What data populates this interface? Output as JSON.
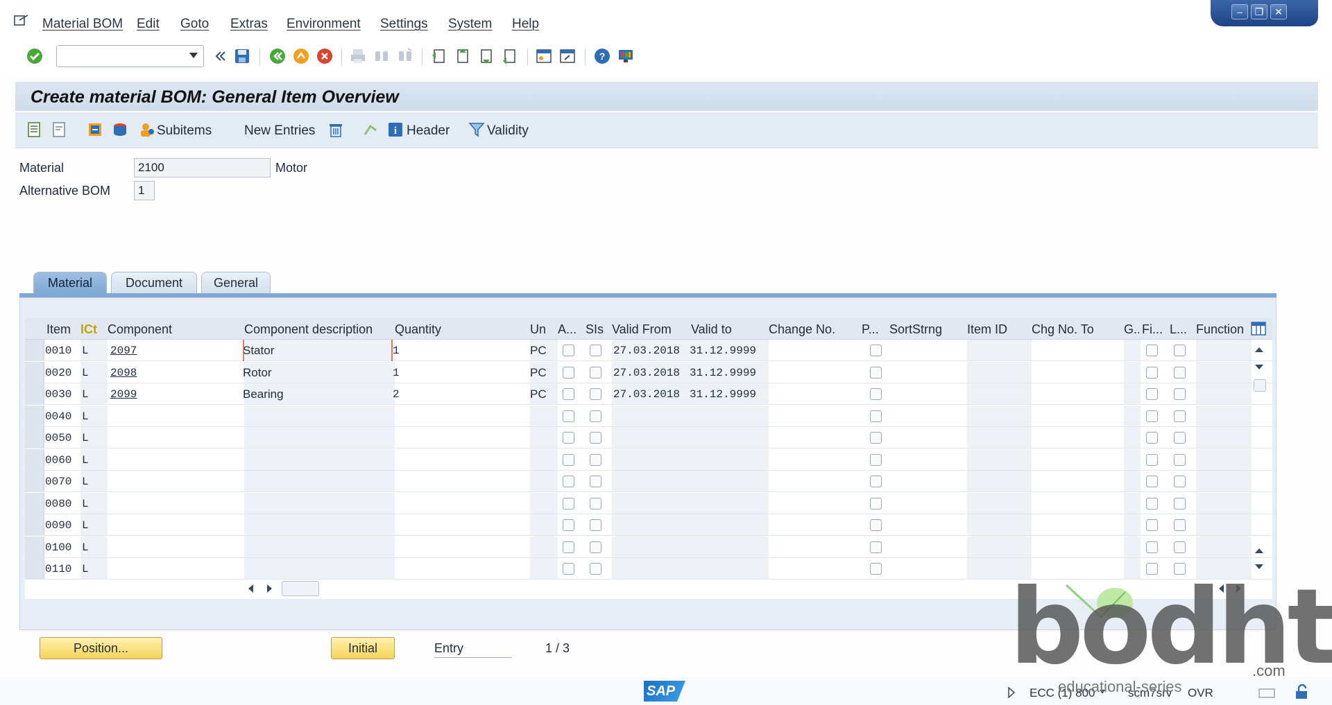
{
  "menubar": {
    "items": [
      "Material BOM",
      "Edit",
      "Goto",
      "Extras",
      "Environment",
      "Settings",
      "System",
      "Help"
    ]
  },
  "toolbar": {
    "command_value": ""
  },
  "title": "Create material BOM: General Item Overview",
  "app_toolbar": {
    "subitems": "Subitems",
    "new_entries": "New Entries",
    "header": "Header",
    "validity": "Validity"
  },
  "form": {
    "material_label": "Material",
    "material_value": "2100",
    "material_desc": "Motor",
    "altbom_label": "Alternative BOM",
    "altbom_value": "1"
  },
  "tabs": [
    "Material",
    "Document",
    "General"
  ],
  "table": {
    "columns": [
      "Item",
      "ICt",
      "Component",
      "Component description",
      "Quantity",
      "Un",
      "A...",
      "SIs",
      "Valid From",
      "Valid to",
      "Change No.",
      "P...",
      "SortStrng",
      "Item ID",
      "Chg No. To",
      "G..",
      "Fi...",
      "L...",
      "Function"
    ],
    "rows": [
      {
        "item": "0010",
        "ict": "L",
        "component": "2097",
        "desc": "Stator",
        "qty": "1",
        "un": "PC",
        "from": "27.03.2018",
        "to": "31.12.9999"
      },
      {
        "item": "0020",
        "ict": "L",
        "component": "2098",
        "desc": "Rotor",
        "qty": "1",
        "un": "PC",
        "from": "27.03.2018",
        "to": "31.12.9999"
      },
      {
        "item": "0030",
        "ict": "L",
        "component": "2099",
        "desc": "Bearing",
        "qty": "2",
        "un": "PC",
        "from": "27.03.2018",
        "to": "31.12.9999"
      },
      {
        "item": "0040",
        "ict": "L",
        "component": "",
        "desc": "",
        "qty": "",
        "un": "",
        "from": "",
        "to": ""
      },
      {
        "item": "0050",
        "ict": "L",
        "component": "",
        "desc": "",
        "qty": "",
        "un": "",
        "from": "",
        "to": ""
      },
      {
        "item": "0060",
        "ict": "L",
        "component": "",
        "desc": "",
        "qty": "",
        "un": "",
        "from": "",
        "to": ""
      },
      {
        "item": "0070",
        "ict": "L",
        "component": "",
        "desc": "",
        "qty": "",
        "un": "",
        "from": "",
        "to": ""
      },
      {
        "item": "0080",
        "ict": "L",
        "component": "",
        "desc": "",
        "qty": "",
        "un": "",
        "from": "",
        "to": ""
      },
      {
        "item": "0090",
        "ict": "L",
        "component": "",
        "desc": "",
        "qty": "",
        "un": "",
        "from": "",
        "to": ""
      },
      {
        "item": "0100",
        "ict": "L",
        "component": "",
        "desc": "",
        "qty": "",
        "un": "",
        "from": "",
        "to": ""
      },
      {
        "item": "0110",
        "ict": "L",
        "component": "",
        "desc": "",
        "qty": "",
        "un": "",
        "from": "",
        "to": ""
      }
    ]
  },
  "bottom": {
    "position_label": "Position...",
    "initial_label": "Initial",
    "entry_label": "Entry",
    "entry_count": "1 / 3"
  },
  "status": {
    "sap": "SAP",
    "system": "ECC (1) 800",
    "server": "scm7srv",
    "mode": "OVR"
  },
  "watermark": {
    "brand": "bodht",
    "suffix": ".com",
    "tagline": "educational-series"
  },
  "colors": {
    "tab_active": "#7ea7d3",
    "button_yellow": "#f5d45c",
    "title_bg": "#cfdcea"
  }
}
